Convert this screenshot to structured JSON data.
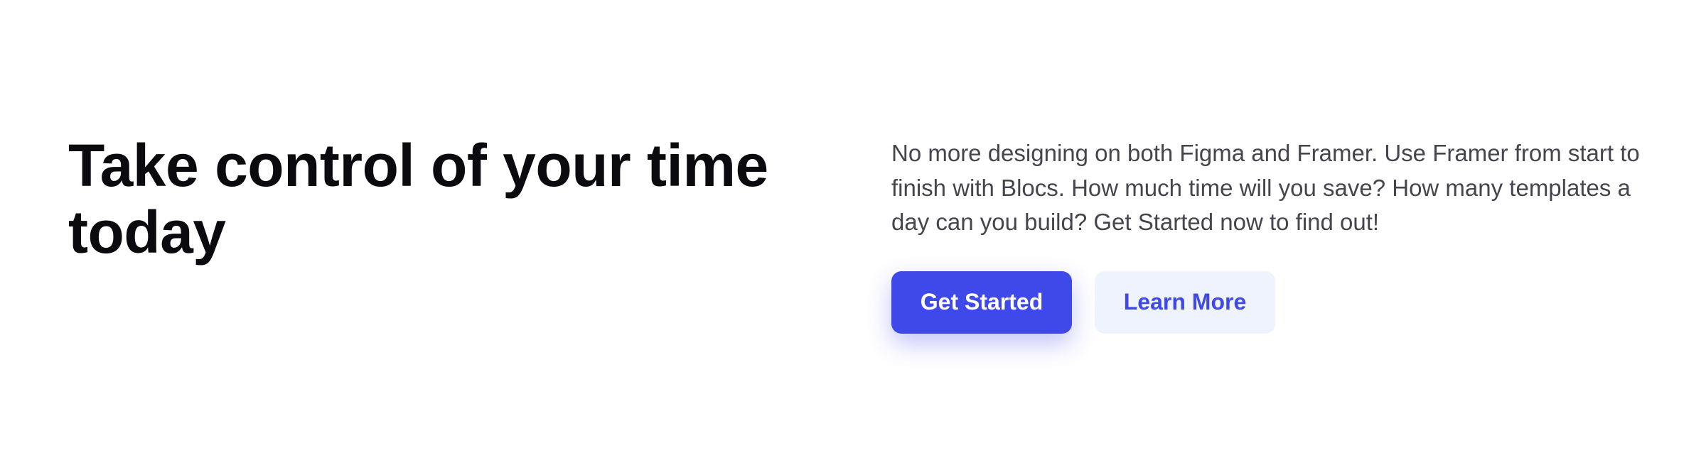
{
  "hero": {
    "headline": "Take control of your time today",
    "description": "No more designing on both Figma and Framer. Use Framer from start to finish with Blocs. How much time will you save? How many templates a day can you build? Get Started now to find out!",
    "primary_button_label": "Get Started",
    "secondary_button_label": "Learn More"
  },
  "colors": {
    "accent": "#3f48e8",
    "secondary_button_bg": "#eef3fd",
    "headline_text": "#0b0b0f",
    "body_text": "#45454d",
    "background": "#ffffff"
  }
}
